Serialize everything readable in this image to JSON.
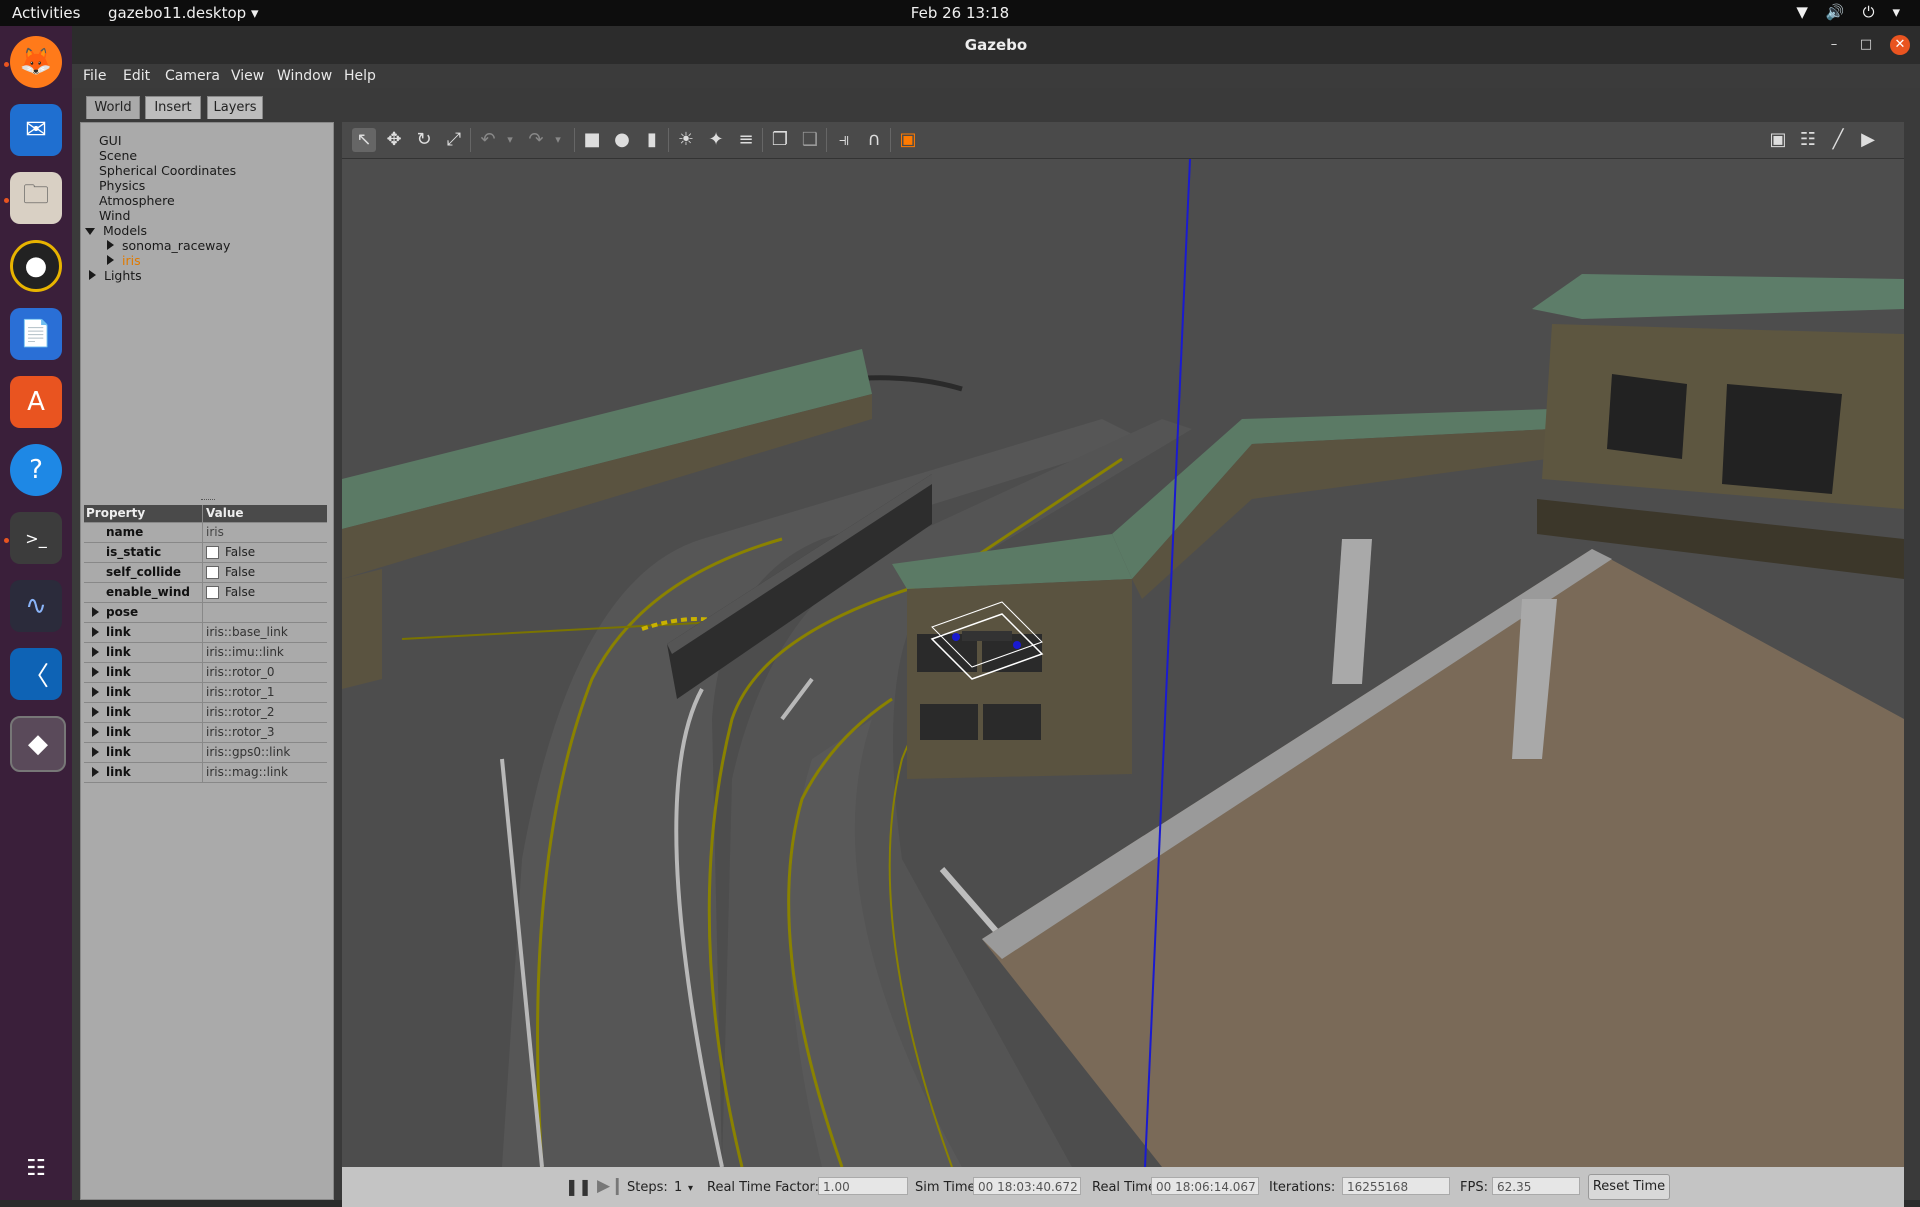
{
  "topbar": {
    "activities": "Activities",
    "app_menu": "gazebo11.desktop ▾",
    "clock": "Feb 26  13:18"
  },
  "window": {
    "title": "Gazebo"
  },
  "menu": [
    "File",
    "Edit",
    "Camera",
    "View",
    "Window",
    "Help"
  ],
  "tabs": [
    "World",
    "Insert",
    "Layers"
  ],
  "tree": {
    "items": [
      "GUI",
      "Scene",
      "Spherical Coordinates",
      "Physics",
      "Atmosphere",
      "Wind"
    ],
    "models_label": "Models",
    "model_children": [
      "sonoma_raceway",
      "iris"
    ],
    "lights_label": "Lights"
  },
  "properties": {
    "header_property": "Property",
    "header_value": "Value",
    "name_key": "name",
    "name_value": "iris",
    "is_static_key": "is_static",
    "is_static_value": "False",
    "self_collide_key": "self_collide",
    "self_collide_value": "False",
    "enable_wind_key": "enable_wind",
    "enable_wind_value": "False",
    "pose_key": "pose",
    "links": [
      {
        "key": "link",
        "value": "iris::base_link"
      },
      {
        "key": "link",
        "value": "iris::imu::link"
      },
      {
        "key": "link",
        "value": "iris::rotor_0"
      },
      {
        "key": "link",
        "value": "iris::rotor_1"
      },
      {
        "key": "link",
        "value": "iris::rotor_2"
      },
      {
        "key": "link",
        "value": "iris::rotor_3"
      },
      {
        "key": "link",
        "value": "iris::gps0::link"
      },
      {
        "key": "link",
        "value": "iris::mag::link"
      }
    ]
  },
  "bottombar": {
    "steps_label": "Steps:",
    "steps_value": "1",
    "rtf_label": "Real Time Factor:",
    "rtf_value": "1.00",
    "sim_time_label": "Sim Time:",
    "sim_time_value": "00 18:03:40.672",
    "real_time_label": "Real Time:",
    "real_time_value": "00 18:06:14.067",
    "iterations_label": "Iterations:",
    "iterations_value": "16255168",
    "fps_label": "FPS:",
    "fps_value": "62.35",
    "reset_label": "Reset Time"
  },
  "colors": {
    "accent": "#e95420",
    "selected_model": "#e07a00",
    "axis_line": "#1a1ad0"
  }
}
